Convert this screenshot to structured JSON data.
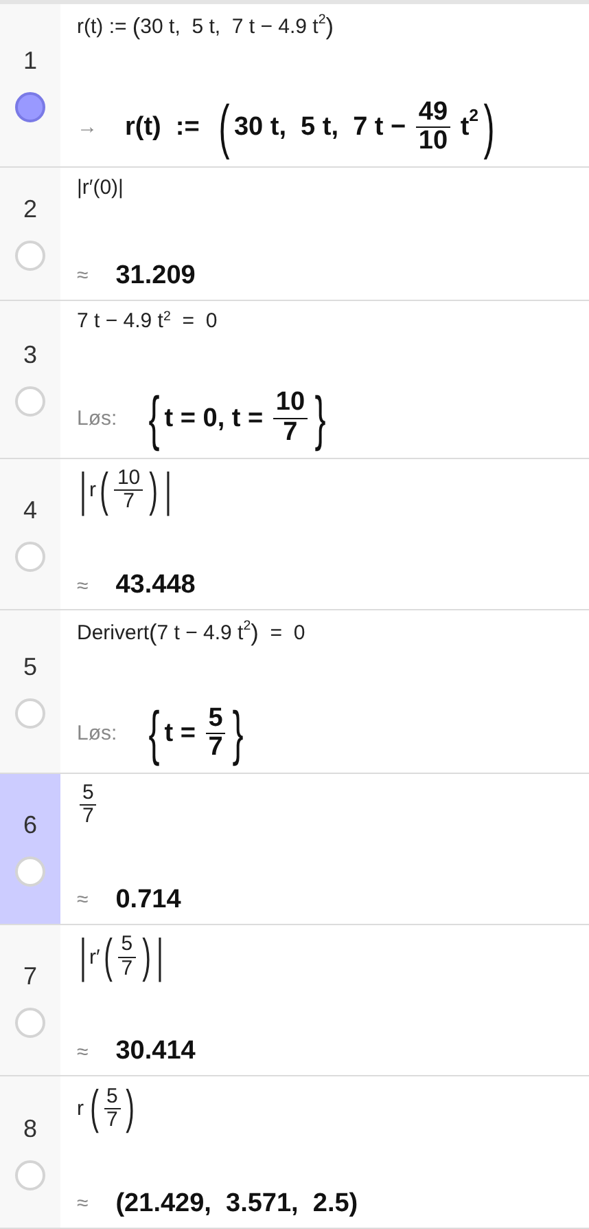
{
  "rows": [
    {
      "number": "1",
      "selected": false,
      "shown": true,
      "input": [
        {
          "kind": "text",
          "text": "r(t) := "
        },
        {
          "kind": "open",
          "text": "("
        },
        {
          "kind": "text",
          "text": "30 t,  5 t,  7 t − 4.9 t"
        },
        {
          "kind": "sup",
          "text": "2"
        },
        {
          "kind": "close",
          "text": ")"
        }
      ],
      "prefix": "→",
      "output": [
        {
          "kind": "text",
          "text": "r(t)  :=  "
        },
        {
          "kind": "bigopen",
          "text": "("
        },
        {
          "kind": "text",
          "text": "30 t,  5 t,  7 t − "
        },
        {
          "kind": "frac",
          "num": "49",
          "den": "10"
        },
        {
          "kind": "text",
          "text": " t"
        },
        {
          "kind": "sup",
          "text": "2"
        },
        {
          "kind": "bigclose",
          "text": ")"
        }
      ]
    },
    {
      "number": "2",
      "selected": false,
      "shown": false,
      "input": [
        {
          "kind": "text",
          "text": "|r′(0)|"
        }
      ],
      "prefix": "≈",
      "output": [
        {
          "kind": "text",
          "text": "31.209"
        }
      ]
    },
    {
      "number": "3",
      "selected": false,
      "shown": false,
      "input": [
        {
          "kind": "text",
          "text": "7 t − 4.9 t"
        },
        {
          "kind": "sup",
          "text": "2"
        },
        {
          "kind": "text",
          "text": "  =  0"
        }
      ],
      "prefix": "Løs:",
      "output": [
        {
          "kind": "bigopen",
          "text": "{"
        },
        {
          "kind": "text",
          "text": "t = 0, t = "
        },
        {
          "kind": "frac",
          "num": "10",
          "den": "7"
        },
        {
          "kind": "bigclose",
          "text": "}"
        }
      ]
    },
    {
      "number": "4",
      "selected": false,
      "shown": false,
      "input": [
        {
          "kind": "bigopen",
          "text": "|"
        },
        {
          "kind": "text",
          "text": "r"
        },
        {
          "kind": "bigopen",
          "text": "("
        },
        {
          "kind": "frac",
          "num": "10",
          "den": "7"
        },
        {
          "kind": "bigclose",
          "text": ")"
        },
        {
          "kind": "bigclose",
          "text": "|"
        }
      ],
      "prefix": "≈",
      "output": [
        {
          "kind": "text",
          "text": "43.448"
        }
      ]
    },
    {
      "number": "5",
      "selected": false,
      "shown": false,
      "input": [
        {
          "kind": "text",
          "text": "Derivert"
        },
        {
          "kind": "open",
          "text": "("
        },
        {
          "kind": "text",
          "text": "7 t − 4.9 t"
        },
        {
          "kind": "sup",
          "text": "2"
        },
        {
          "kind": "close",
          "text": ")"
        },
        {
          "kind": "text",
          "text": "  =  0"
        }
      ],
      "prefix": "Løs:",
      "output": [
        {
          "kind": "bigopen",
          "text": "{"
        },
        {
          "kind": "text",
          "text": "t = "
        },
        {
          "kind": "frac",
          "num": "5",
          "den": "7"
        },
        {
          "kind": "bigclose",
          "text": "}"
        }
      ]
    },
    {
      "number": "6",
      "selected": true,
      "shown": false,
      "input": [
        {
          "kind": "frac",
          "num": "5",
          "den": "7"
        }
      ],
      "prefix": "≈",
      "output": [
        {
          "kind": "text",
          "text": "0.714"
        }
      ]
    },
    {
      "number": "7",
      "selected": false,
      "shown": false,
      "input": [
        {
          "kind": "bigopen",
          "text": "|"
        },
        {
          "kind": "text",
          "text": "r′"
        },
        {
          "kind": "bigopen",
          "text": "("
        },
        {
          "kind": "frac",
          "num": "5",
          "den": "7"
        },
        {
          "kind": "bigclose",
          "text": ")"
        },
        {
          "kind": "bigclose",
          "text": "|"
        }
      ],
      "prefix": "≈",
      "output": [
        {
          "kind": "text",
          "text": "30.414"
        }
      ]
    },
    {
      "number": "8",
      "selected": false,
      "shown": false,
      "input": [
        {
          "kind": "call",
          "name": "r",
          "open": "(",
          "num": "5",
          "den": "7",
          "close": ")"
        }
      ],
      "prefix": "≈",
      "output": [
        {
          "kind": "text",
          "text": "(21.429,  3.571,  2.5)"
        }
      ]
    }
  ]
}
